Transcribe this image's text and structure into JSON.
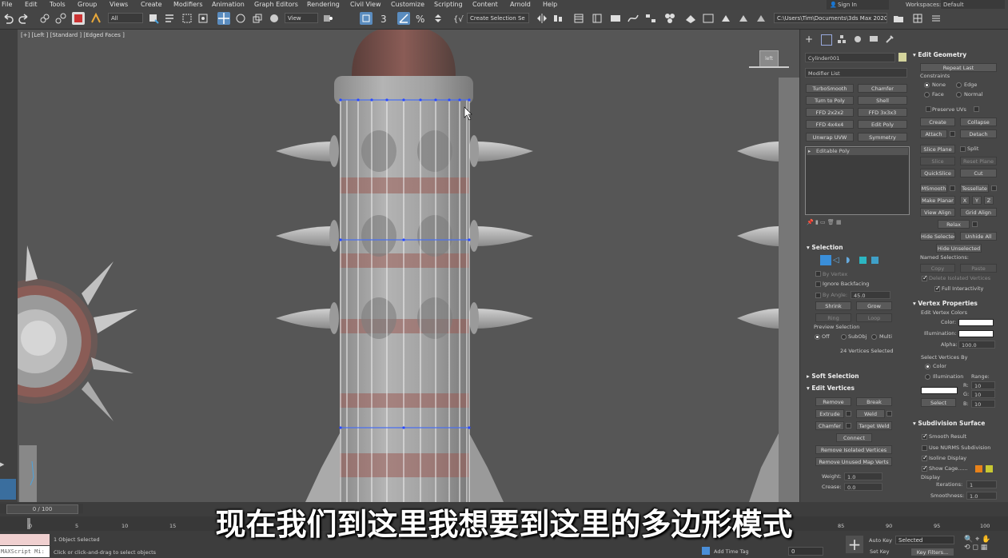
{
  "menu": [
    "File",
    "Edit",
    "Tools",
    "Group",
    "Views",
    "Create",
    "Modifiers",
    "Animation",
    "Graph Editors",
    "Rendering",
    "Civil View",
    "Customize",
    "Scripting",
    "Content",
    "Arnold",
    "Help"
  ],
  "account": {
    "sign_in": "Sign In",
    "workspaces_label": "Workspaces:",
    "workspace": "Default"
  },
  "toolbar": {
    "filter_value": "All",
    "refcoord_value": "View",
    "selection_set_placeholder": "Create Selection Se",
    "project_path": "C:\\Users\\Tim\\Documents\\3ds Max 2020"
  },
  "viewport": {
    "label": "[+] [Left ] [Standard ] [Edged Faces ]",
    "viewcube_label": "left"
  },
  "cmd": {
    "object_name": "Cylinder001",
    "object_color": "#d4d49c",
    "modifier_list": "Modifier List",
    "modifier_buttons": [
      "TurboSmooth",
      "Chamfer",
      "Turn to Poly",
      "Shell",
      "FFD 2x2x2",
      "FFD 3x3x3",
      "FFD 4x4x4",
      "Edit Poly",
      "Unwrap UVW",
      "Symmetry"
    ],
    "stack_item": "Editable Poly",
    "selection": {
      "header": "Selection",
      "by_vertex": "By Vertex",
      "ignore_backfacing": "Ignore Backfacing",
      "by_angle": "By Angle:",
      "angle_value": "45.0",
      "shrink": "Shrink",
      "grow": "Grow",
      "ring": "Ring",
      "loop": "Loop",
      "preview_selection": "Preview Selection",
      "off": "Off",
      "subobj": "SubObj",
      "multi": "Multi",
      "status": "24 Vertices Selected"
    },
    "soft_selection": "Soft Selection",
    "edit_vertices": {
      "header": "Edit Vertices",
      "remove": "Remove",
      "break": "Break",
      "extrude": "Extrude",
      "weld": "Weld",
      "chamfer": "Chamfer",
      "target_weld": "Target Weld",
      "connect": "Connect",
      "remove_isolated": "Remove Isolated Vertices",
      "remove_unused": "Remove Unused Map Verts",
      "weight_label": "Weight:",
      "weight": "1.0",
      "crease_label": "Crease:",
      "crease": "0.0"
    },
    "edit_geometry": {
      "header": "Edit Geometry",
      "repeat_last": "Repeat Last",
      "constraints": "Constraints",
      "none": "None",
      "edge": "Edge",
      "face": "Face",
      "normal": "Normal",
      "preserve_uvs": "Preserve UVs",
      "create": "Create",
      "collapse": "Collapse",
      "attach": "Attach",
      "detach": "Detach",
      "slice_plane": "Slice Plane",
      "split": "Split",
      "slice": "Slice",
      "reset_plane": "Reset Plane",
      "quickslice": "QuickSlice",
      "cut": "Cut",
      "msmooth": "MSmooth",
      "tessellate": "Tessellate",
      "make_planar": "Make Planar",
      "x": "X",
      "y": "Y",
      "z": "Z",
      "view_align": "View Align",
      "grid_align": "Grid Align",
      "relax": "Relax",
      "hide_selected": "Hide Selected",
      "unhide_all": "Unhide All",
      "hide_unselected": "Hide Unselected",
      "named_selections": "Named Selections:",
      "copy": "Copy",
      "paste": "Paste",
      "delete_isolated": "Delete Isolated Vertices",
      "full_interactivity": "Full Interactivity"
    },
    "vertex_properties": {
      "header": "Vertex Properties",
      "edit_vertex_colors": "Edit Vertex Colors",
      "color": "Color:",
      "illumination": "Illumination:",
      "alpha": "Alpha:",
      "alpha_value": "100.0",
      "select_by": "Select Vertices By",
      "color_opt": "Color",
      "illum_opt": "Illumination",
      "range": "Range:",
      "r": "R:",
      "g": "G:",
      "b": "B:",
      "r_val": "10",
      "g_val": "10",
      "b_val": "10",
      "select": "Select"
    },
    "subdivision": {
      "header": "Subdivision Surface",
      "smooth_result": "Smooth Result",
      "use_nurms": "Use NURMS Subdivision",
      "isoline": "Isoline Display",
      "show_cage": "Show Cage......",
      "cage_color1": "#e8821a",
      "cage_color2": "#c8c832",
      "display": "Display",
      "iterations_label": "Iterations:",
      "iterations": "1",
      "smoothness_label": "Smoothness:",
      "smoothness": "1.0"
    }
  },
  "timeline": {
    "frame_counter": "0 / 100",
    "ticks": [
      "0",
      "5",
      "10",
      "15",
      "85",
      "90",
      "95",
      "100"
    ],
    "status_selected": "1 Object Selected",
    "status_hint": "Click or click-and-drag to select objects",
    "maxscript": "MAXScript Mi:",
    "add_time_tag": "Add Time Tag",
    "auto_key": "Auto Key",
    "set_key": "Set Key",
    "key_mode": "Selected",
    "key_filters": "Key Filters...",
    "frame_value": "0"
  },
  "subtitle": "现在我们到这里我想要到这里的多边形模式"
}
